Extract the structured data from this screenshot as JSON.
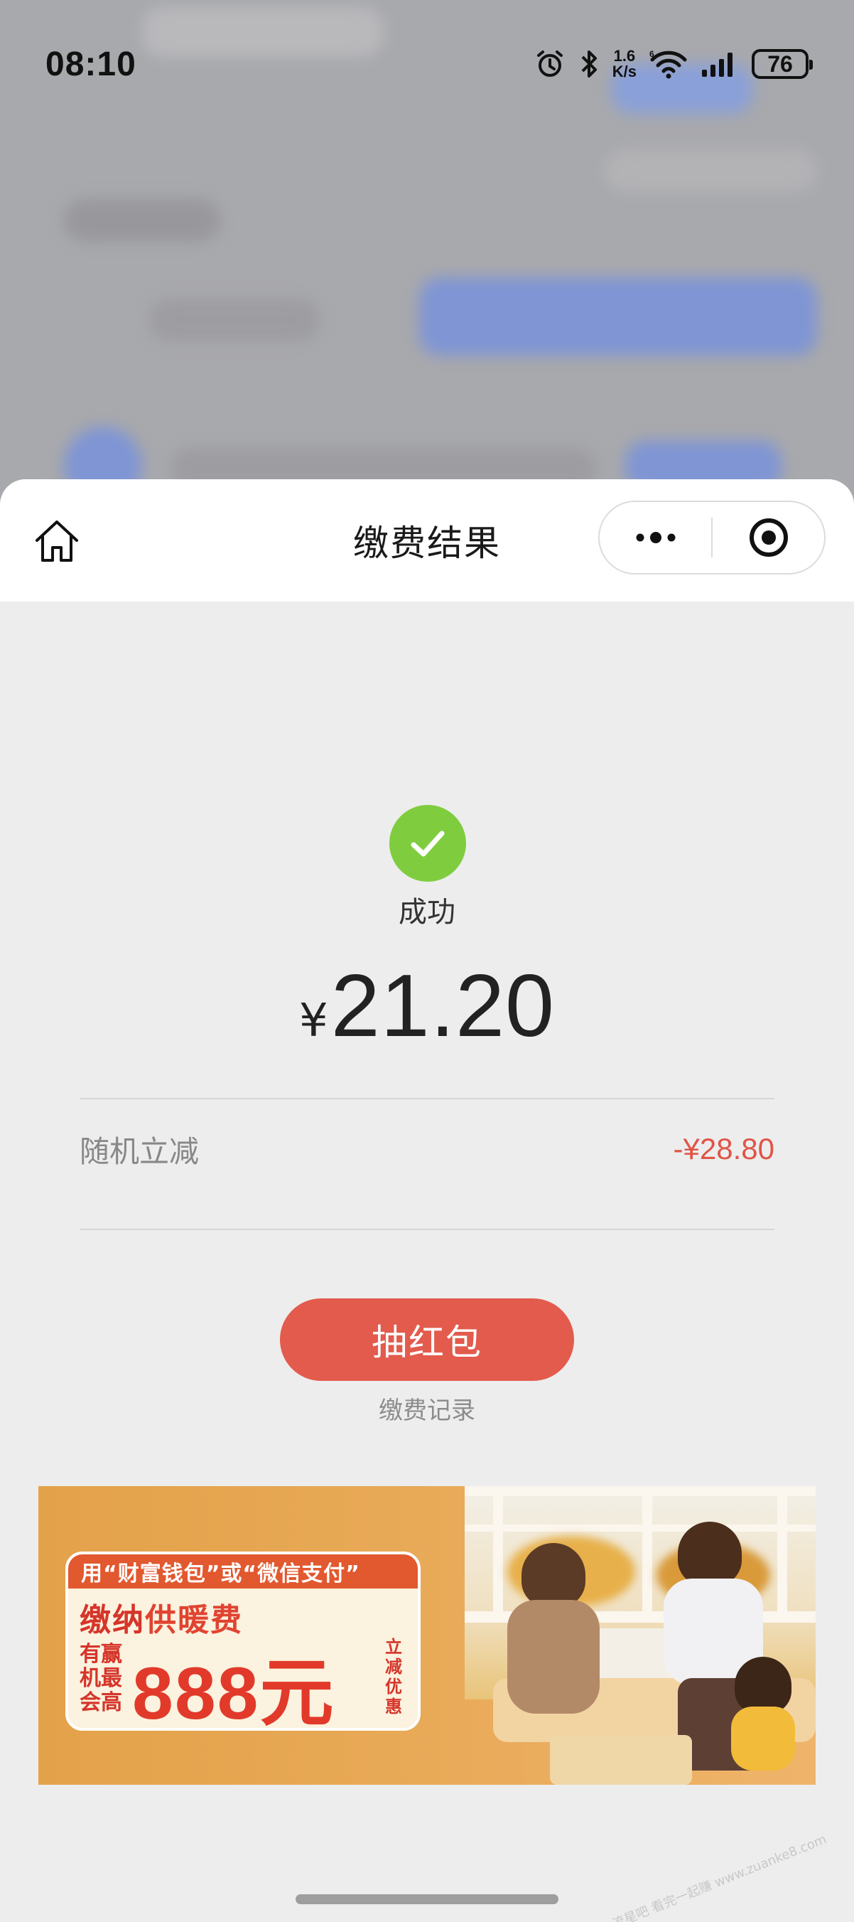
{
  "status_bar": {
    "time": "08:10",
    "net_speed_value": "1.6",
    "net_speed_unit": "K/s",
    "battery": "76",
    "icons": [
      "alarm-icon",
      "bluetooth-icon",
      "wifi-6-icon",
      "signal-icon",
      "battery-icon"
    ]
  },
  "nav": {
    "title": "缴费结果",
    "icons": [
      "home-icon",
      "more-icon",
      "close-target-icon"
    ]
  },
  "result": {
    "status": "成功",
    "currency": "¥",
    "amount": "21.20",
    "discount_label": "随机立减",
    "discount_value": "-¥28.80"
  },
  "actions": {
    "primary_label": "抽红包",
    "record_link": "缴费记录"
  },
  "banner": {
    "top_line": "用“财富钱包”或“微信支付”",
    "title_prefix": "缴纳",
    "title_highlight": "供暖费",
    "side_text": "有赢机最会高",
    "big_text": "888元",
    "vertical_text": "立减优惠"
  },
  "watermark": "流星吧 看完一起赚 www.zuanke8.com",
  "colors": {
    "success_green": "#7fcd3f",
    "discount_red": "#e05447",
    "cta_red": "#e25b4d",
    "page_bg": "#ededed"
  }
}
